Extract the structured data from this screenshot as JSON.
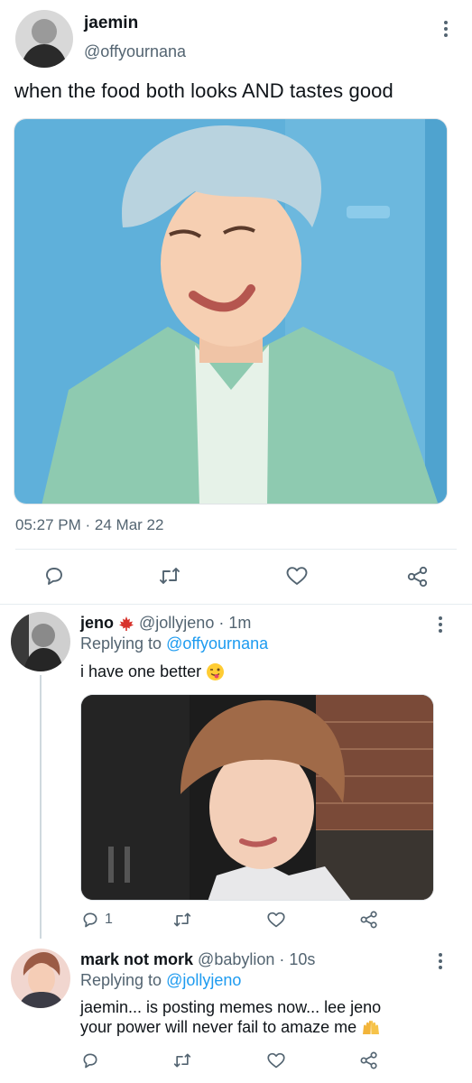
{
  "main_tweet": {
    "display_name": "jaemin",
    "handle": "@offyournana",
    "text": "when the food both looks AND tastes good",
    "time": "05:27 PM",
    "date": "24 Mar 22",
    "separator": "·",
    "actions": [
      "reply-icon",
      "retweet-icon",
      "like-icon",
      "share-icon"
    ]
  },
  "replies": [
    {
      "display_name": "jeno",
      "name_emoji": "maple-leaf-icon",
      "handle": "@jollyjeno",
      "age": "1m",
      "replying_label": "Replying to",
      "replying_to": "@offyournana",
      "text": "i have one better",
      "text_emoji": "winking-tongue-face-icon",
      "reply_count": "1"
    },
    {
      "display_name": "mark not mork",
      "handle": "@babylion",
      "age": "10s",
      "replying_label": "Replying to",
      "replying_to": "@jollyjeno",
      "text_line1": "jaemin... is posting memes now... lee jeno",
      "text_line2": "your power will never fail to amaze me",
      "text_emoji": "raising-hands-icon"
    }
  ],
  "colors": {
    "link": "#1d9bf0",
    "secondary_text": "#536471",
    "primary_text": "#0f1419",
    "divider": "#e6ecf0"
  }
}
